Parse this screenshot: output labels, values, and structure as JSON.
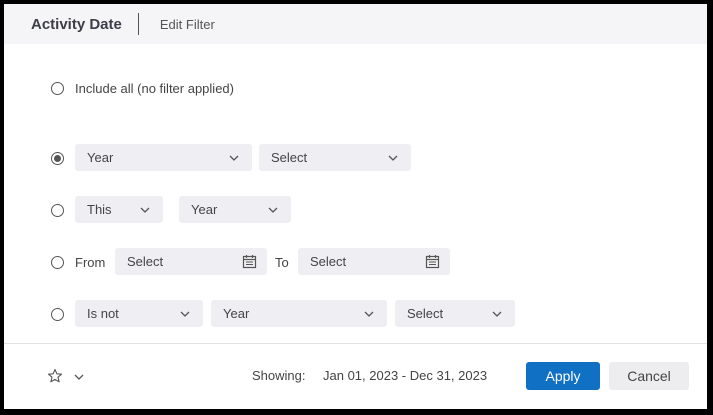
{
  "header": {
    "title": "Activity Date",
    "subtitle": "Edit Filter"
  },
  "options": {
    "include_all": {
      "label": "Include all (no filter applied)",
      "selected": false
    },
    "row1": {
      "selected": true,
      "period": "Year",
      "value": "Select"
    },
    "row2": {
      "selected": false,
      "relative": "This",
      "period": "Year"
    },
    "row3": {
      "selected": false,
      "from_label": "From",
      "from_value": "Select",
      "to_label": "To",
      "to_value": "Select"
    },
    "row4": {
      "selected": false,
      "operator": "Is not",
      "period": "Year",
      "value": "Select"
    }
  },
  "footer": {
    "showing_label": "Showing:",
    "range": "Jan 01, 2023 - Dec 31, 2023",
    "apply_label": "Apply",
    "cancel_label": "Cancel"
  },
  "icons": {
    "favorite": "star-icon",
    "dropdown": "chevron-down-icon",
    "date": "calendar-icon"
  },
  "colors": {
    "accent": "#1070c4",
    "field_bg": "#efeff3",
    "header_bg": "#f5f5f7"
  }
}
